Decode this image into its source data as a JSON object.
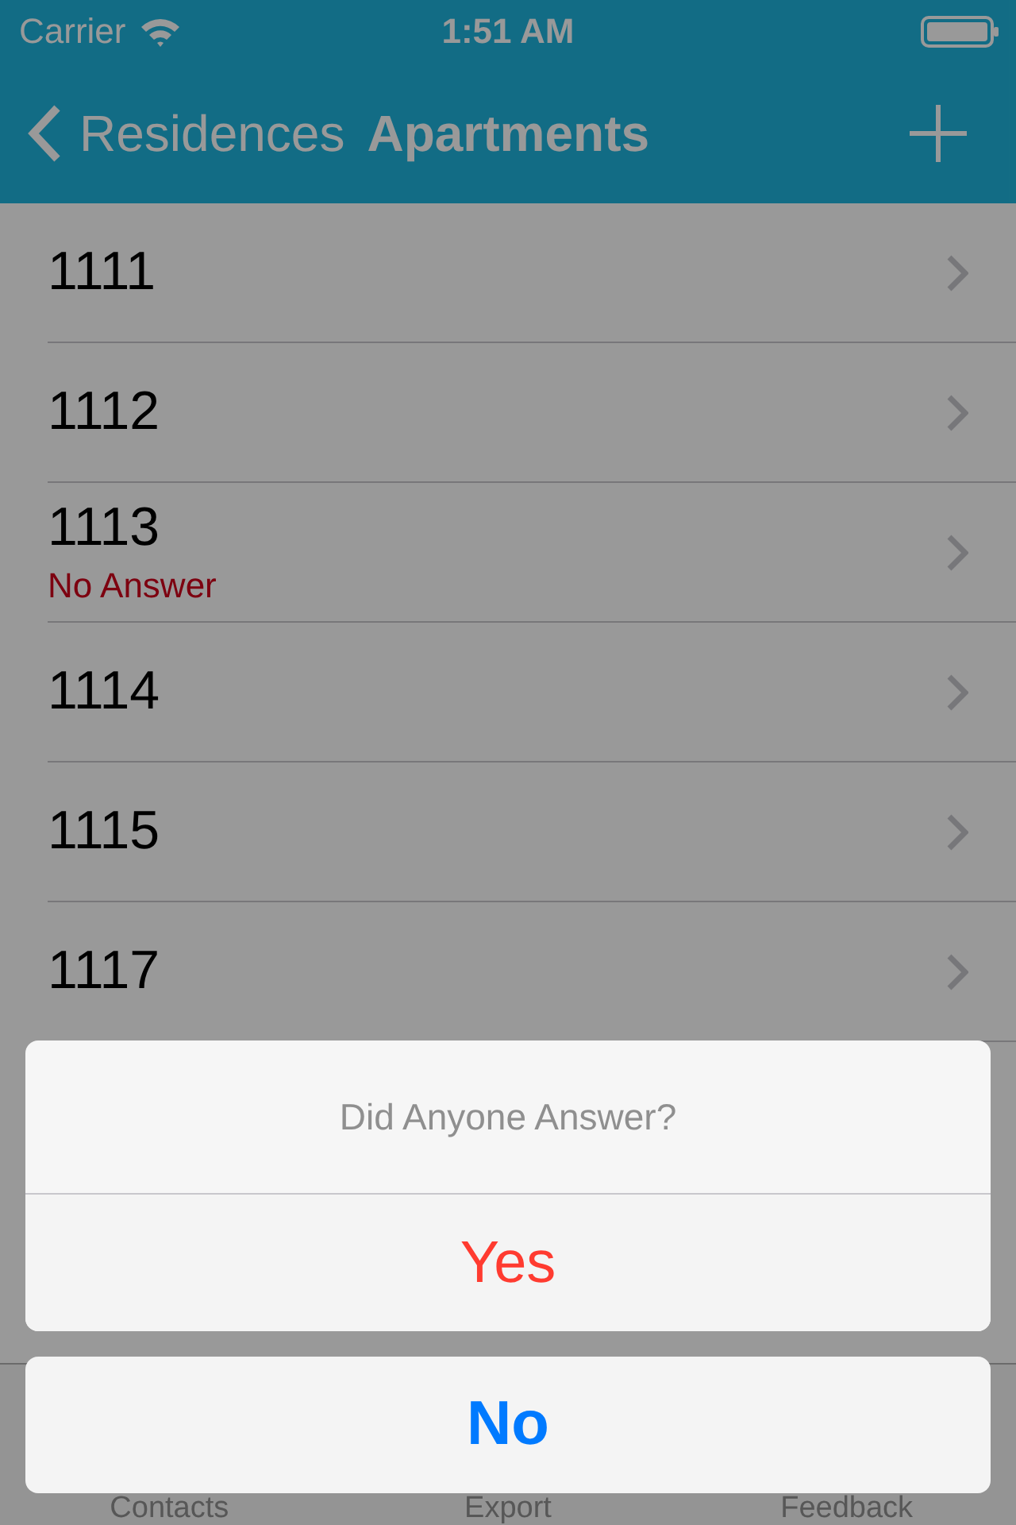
{
  "status_bar": {
    "carrier": "Carrier",
    "time": "1:51 AM"
  },
  "nav_bar": {
    "back_label": "Residences",
    "title": "Apartments"
  },
  "apartments": [
    {
      "number": "1111"
    },
    {
      "number": "1112"
    },
    {
      "number": "1113",
      "status": "No Answer"
    },
    {
      "number": "1114"
    },
    {
      "number": "1115"
    },
    {
      "number": "1117"
    }
  ],
  "tab_bar": {
    "tabs": [
      {
        "label": "Contacts"
      },
      {
        "label": "Export"
      },
      {
        "label": "Feedback"
      }
    ]
  },
  "action_sheet": {
    "title": "Did Anyone Answer?",
    "buttons": [
      {
        "label": "Yes",
        "kind": "destructive"
      },
      {
        "label": "No",
        "kind": "cancel"
      }
    ]
  }
}
